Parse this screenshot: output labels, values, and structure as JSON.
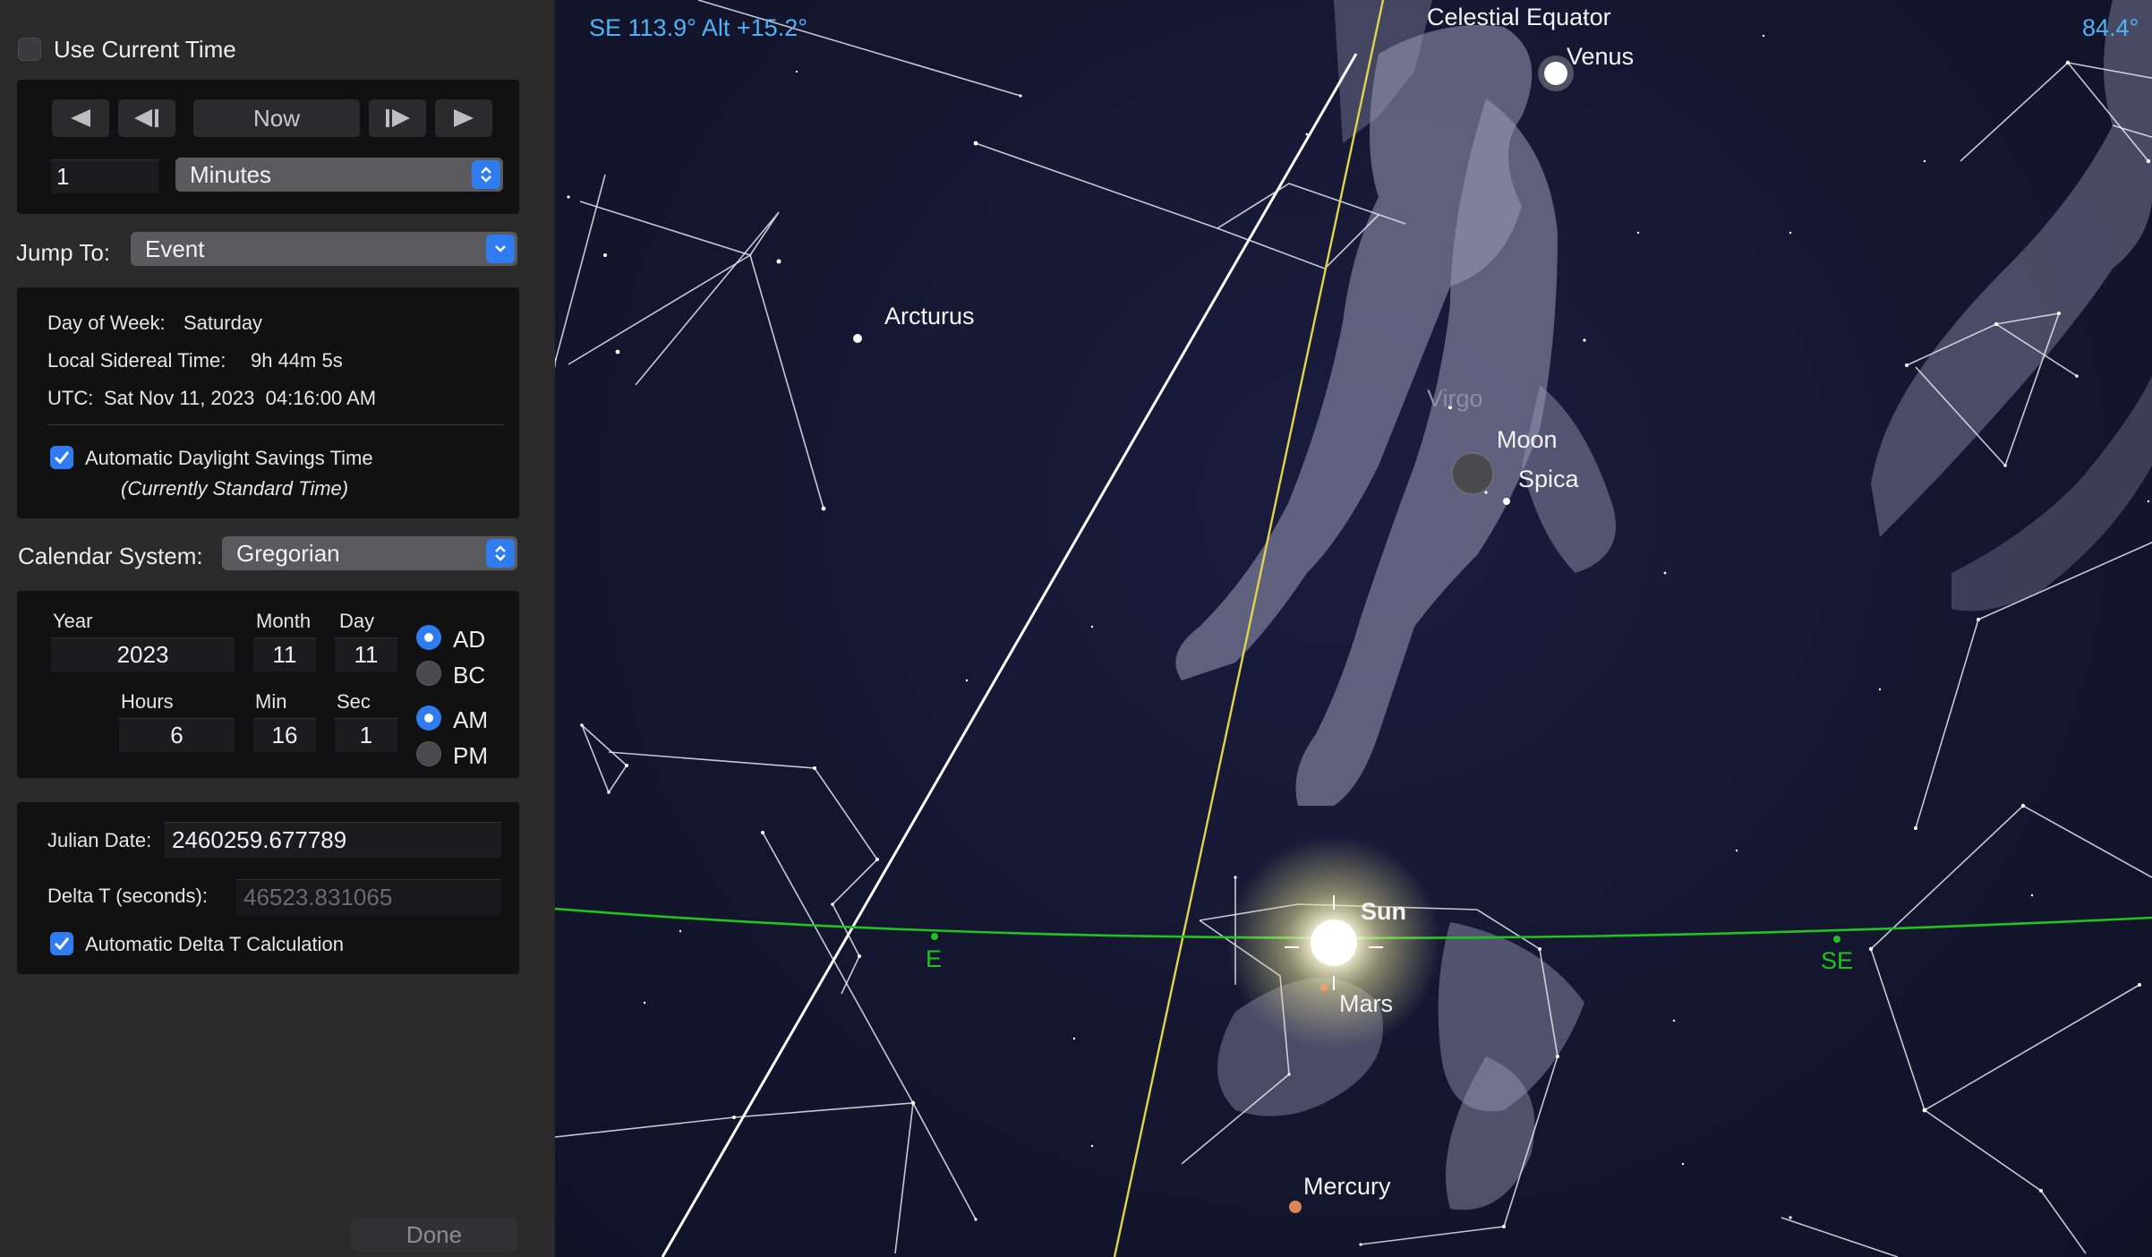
{
  "panel": {
    "use_current_time": {
      "label": "Use Current Time",
      "checked": false
    },
    "step_controls": {
      "now_label": "Now",
      "step_value": "1",
      "step_unit": "Minutes"
    },
    "jump_to": {
      "label": "Jump To:",
      "value": "Event"
    },
    "info": {
      "day_of_week_label": "Day of Week:",
      "day_of_week_value": "Saturday",
      "sidereal_label": "Local Sidereal Time:",
      "sidereal_value": "9h 44m 5s",
      "utc_label": "UTC:",
      "utc_value": "Sat Nov 11, 2023  04:16:00 AM",
      "dst_label": "Automatic Daylight Savings Time",
      "dst_checked": true,
      "dst_note": "(Currently Standard Time)"
    },
    "calendar": {
      "label": "Calendar System:",
      "value": "Gregorian"
    },
    "date": {
      "year_label": "Year",
      "year": "2023",
      "month_label": "Month",
      "month": "11",
      "day_label": "Day",
      "day": "11",
      "hours_label": "Hours",
      "hours": "6",
      "min_label": "Min",
      "min": "16",
      "sec_label": "Sec",
      "sec": "1",
      "ad_label": "AD",
      "bc_label": "BC",
      "era_selected": "AD",
      "am_label": "AM",
      "pm_label": "PM",
      "meridiem_selected": "AM"
    },
    "julian": {
      "julian_label": "Julian Date:",
      "julian_value": "2460259.677789",
      "delta_t_label": "Delta T (seconds):",
      "delta_t_value": "46523.831065",
      "auto_delta_label": "Automatic Delta T Calculation",
      "auto_delta_checked": true
    },
    "done_label": "Done"
  },
  "sky": {
    "readout": "SE 113.9° Alt +15.2°",
    "fov": "84.4°",
    "labels": {
      "celestial_equator": "Celestial Equator",
      "venus": "Venus",
      "arcturus": "Arcturus",
      "virgo": "Virgo",
      "moon": "Moon",
      "spica": "Spica",
      "sun": "Sun",
      "mars": "Mars",
      "mercury": "Mercury",
      "east": "E",
      "southeast": "SE"
    },
    "colors": {
      "readout": "#4fb3f5",
      "horizon": "#1fc41f",
      "ecliptic": "#e0d54a",
      "equator": "#ffffff",
      "constellation": "#e8e8ee",
      "accent": "#2f7bf0"
    }
  }
}
